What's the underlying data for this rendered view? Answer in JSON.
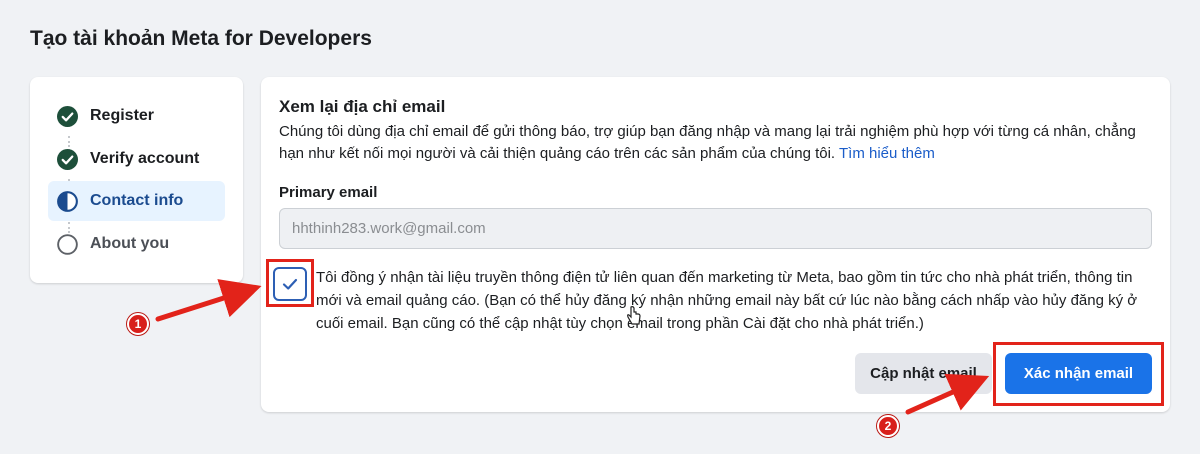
{
  "page": {
    "title": "Tạo tài khoản Meta for Developers"
  },
  "steps": [
    {
      "label": "Register",
      "status": "done",
      "icon": "check-circle-icon"
    },
    {
      "label": "Verify account",
      "status": "done",
      "icon": "check-circle-icon"
    },
    {
      "label": "Contact info",
      "status": "current",
      "icon": "half-circle-icon"
    },
    {
      "label": "About you",
      "status": "pending",
      "icon": "empty-circle-icon"
    }
  ],
  "card": {
    "title": "Xem lại địa chỉ email",
    "description": "Chúng tôi dùng địa chỉ email để gửi thông báo, trợ giúp bạn đăng nhập và mang lại trải nghiệm phù hợp với từng cá nhân, chẳng hạn như kết nối mọi người và cải thiện quảng cáo trên các sản phẩm của chúng tôi.",
    "learn_more": "Tìm hiểu thêm",
    "email_label": "Primary email",
    "email_value": "hhthinh283.work@gmail.com",
    "consent_checked": true,
    "consent_text": "Tôi đồng ý nhận tài liệu truyền thông điện tử liên quan đến marketing từ Meta, bao gồm tin tức cho nhà phát triển, thông tin mới và email quảng cáo. (Bạn có thể hủy đăng ký nhận những email này bất cứ lúc nào bằng cách nhấp vào hủy đăng ký ở cuối email. Bạn cũng có thể cập nhật tùy chọn email trong phần Cài đặt cho nhà phát triển.)",
    "update_button": "Cập nhật email",
    "confirm_button": "Xác nhận email"
  },
  "annotations": {
    "badge_1": "1",
    "badge_2": "2"
  },
  "colors": {
    "accent": "#1a73e8",
    "step_done": "#1d4f3a",
    "step_current": "#1b4b8f",
    "annotation_red": "#e2231a"
  }
}
